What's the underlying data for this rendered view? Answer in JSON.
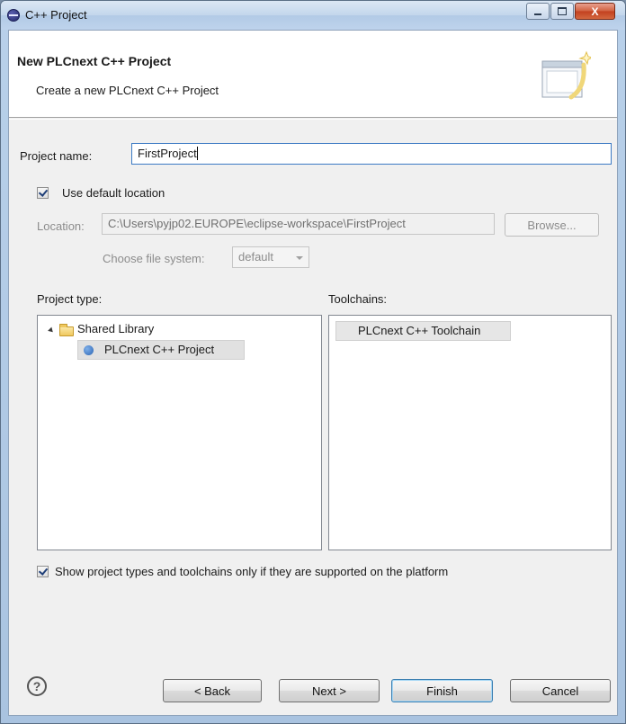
{
  "window": {
    "title": "C++ Project",
    "minimize_icon": "minimize-icon",
    "maximize_icon": "maximize-icon",
    "close_icon": "close-icon",
    "close_glyph": "X"
  },
  "banner": {
    "title": "New PLCnext C++ Project",
    "subtitle": "Create a new PLCnext C++ Project",
    "icon": "wizard-banner-icon"
  },
  "project_name": {
    "label": "Project name:",
    "value": "FirstProject"
  },
  "default_location": {
    "label": "Use default location",
    "checked": true
  },
  "location": {
    "label": "Location:",
    "value": "C:\\Users\\pyjp02.EUROPE\\eclipse-workspace\\FirstProject",
    "browse_label": "Browse..."
  },
  "file_system": {
    "label": "Choose file system:",
    "value": "default"
  },
  "project_type": {
    "label": "Project type:",
    "tree": [
      {
        "label": "Shared Library",
        "icon": "folder-icon",
        "expanded": true
      },
      {
        "label": "PLCnext C++ Project",
        "icon": "project-dot-icon",
        "selected": true
      }
    ]
  },
  "toolchains": {
    "label": "Toolchains:",
    "items": [
      "PLCnext C++ Toolchain"
    ]
  },
  "show_supported": {
    "label": "Show project types and toolchains only if they are supported on the platform",
    "checked": true
  },
  "footer": {
    "help_icon": "help-icon",
    "help_glyph": "?",
    "back_label": "< Back",
    "next_label": "Next >",
    "finish_label": "Finish",
    "cancel_label": "Cancel"
  }
}
